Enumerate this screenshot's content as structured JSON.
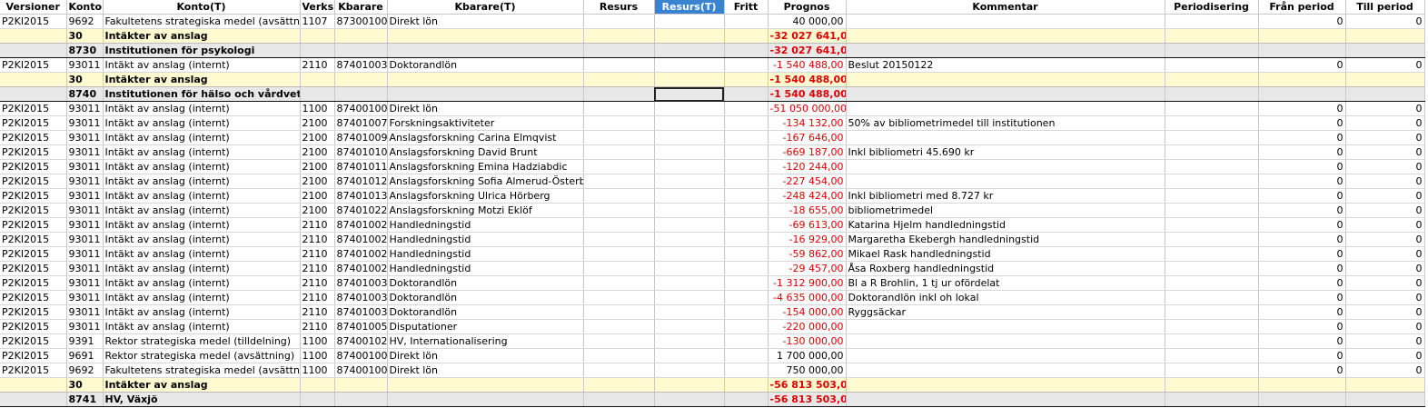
{
  "headers": [
    "Versioner",
    "Konto",
    "Konto(T)",
    "Verks",
    "Kbarare",
    "Kbarare(T)",
    "Resurs",
    "Resurs(T)",
    "Fritt",
    "Prognos",
    "Kommentar",
    "Periodisering",
    "Från period",
    "Till period"
  ],
  "rows": [
    {
      "type": "data",
      "cells": [
        "P2KI2015",
        "9692",
        "Fakultetens strategiska medel (avsättning)",
        "1107",
        "87300100",
        "Direkt lön",
        "",
        "",
        "",
        "40 000,00",
        "",
        "",
        "0",
        "0"
      ],
      "neg": false
    },
    {
      "type": "sub30",
      "cells": [
        "",
        "30",
        "Intäkter av anslag",
        "",
        "",
        "",
        "",
        "",
        "",
        "-32 027 641,00",
        "",
        "",
        "",
        ""
      ],
      "neg": true
    },
    {
      "type": "sub87",
      "cells": [
        "",
        "8730",
        "Institutionen för psykologi",
        "",
        "",
        "",
        "",
        "",
        "",
        "-32 027 641,00",
        "",
        "",
        "",
        ""
      ],
      "neg": true
    },
    {
      "type": "data",
      "cells": [
        "P2KI2015",
        "93011",
        "Intäkt av anslag (internt)",
        "2110",
        "87401003",
        "Doktorandlön",
        "",
        "",
        "",
        "-1 540 488,00",
        "Beslut 20150122",
        "",
        "0",
        "0"
      ],
      "neg": true
    },
    {
      "type": "sub30",
      "cells": [
        "",
        "30",
        "Intäkter av anslag",
        "",
        "",
        "",
        "",
        "",
        "",
        "-1 540 488,00",
        "",
        "",
        "",
        ""
      ],
      "neg": true
    },
    {
      "type": "sub87",
      "cells": [
        "",
        "8740",
        "Institutionen för hälso och vårdvetens",
        "",
        "",
        "",
        "",
        "",
        "",
        "-1 540 488,00",
        "",
        "",
        "",
        ""
      ],
      "neg": true
    },
    {
      "type": "data",
      "cells": [
        "P2KI2015",
        "93011",
        "Intäkt av anslag (internt)",
        "1100",
        "87400100",
        "Direkt lön",
        "",
        "",
        "",
        "-51 050 000,00",
        "",
        "",
        "0",
        "0"
      ],
      "neg": true
    },
    {
      "type": "data",
      "cells": [
        "P2KI2015",
        "93011",
        "Intäkt av anslag (internt)",
        "2100",
        "87401007",
        "Forskningsaktiviteter",
        "",
        "",
        "",
        "-134 132,00",
        "50% av bibliometrimedel till institutionen",
        "",
        "0",
        "0"
      ],
      "neg": true
    },
    {
      "type": "data",
      "cells": [
        "P2KI2015",
        "93011",
        "Intäkt av anslag (internt)",
        "2100",
        "87401009",
        "Anslagsforskning Carina Elmqvist",
        "",
        "",
        "",
        "-167 646,00",
        "",
        "",
        "0",
        "0"
      ],
      "neg": true
    },
    {
      "type": "data",
      "cells": [
        "P2KI2015",
        "93011",
        "Intäkt av anslag (internt)",
        "2100",
        "87401010",
        "Anslagsforskning David Brunt",
        "",
        "",
        "",
        "-669 187,00",
        "Inkl bibliometri 45.690 kr",
        "",
        "0",
        "0"
      ],
      "neg": true
    },
    {
      "type": "data",
      "cells": [
        "P2KI2015",
        "93011",
        "Intäkt av anslag (internt)",
        "2100",
        "87401011",
        "Anslagsforskning Emina Hadziabdic",
        "",
        "",
        "",
        "-120 244,00",
        "",
        "",
        "0",
        "0"
      ],
      "neg": true
    },
    {
      "type": "data",
      "cells": [
        "P2KI2015",
        "93011",
        "Intäkt av anslag (internt)",
        "2100",
        "87401012",
        "Anslagsforskning Sofia Almerud-Österberg",
        "",
        "",
        "",
        "-227 454,00",
        "",
        "",
        "0",
        "0"
      ],
      "neg": true
    },
    {
      "type": "data",
      "cells": [
        "P2KI2015",
        "93011",
        "Intäkt av anslag (internt)",
        "2100",
        "87401013",
        "Anslagsforskning Ulrica Hörberg",
        "",
        "",
        "",
        "-248 424,00",
        "Inkl bibliometri med 8.727 kr",
        "",
        "0",
        "0"
      ],
      "neg": true
    },
    {
      "type": "data",
      "cells": [
        "P2KI2015",
        "93011",
        "Intäkt av anslag (internt)",
        "2100",
        "87401022",
        "Anslagsforskning Motzi Eklöf",
        "",
        "",
        "",
        "-18 655,00",
        "bibliometrimedel",
        "",
        "0",
        "0"
      ],
      "neg": true
    },
    {
      "type": "data",
      "cells": [
        "P2KI2015",
        "93011",
        "Intäkt av anslag (internt)",
        "2110",
        "87401002",
        "Handledningstid",
        "",
        "",
        "",
        "-69 613,00",
        "Katarina Hjelm handledningstid",
        "",
        "0",
        "0"
      ],
      "neg": true
    },
    {
      "type": "data",
      "cells": [
        "P2KI2015",
        "93011",
        "Intäkt av anslag (internt)",
        "2110",
        "87401002",
        "Handledningstid",
        "",
        "",
        "",
        "-16 929,00",
        "Margaretha Ekebergh handledningstid",
        "",
        "0",
        "0"
      ],
      "neg": true
    },
    {
      "type": "data",
      "cells": [
        "P2KI2015",
        "93011",
        "Intäkt av anslag (internt)",
        "2110",
        "87401002",
        "Handledningstid",
        "",
        "",
        "",
        "-59 862,00",
        "Mikael Rask handledningstid",
        "",
        "0",
        "0"
      ],
      "neg": true
    },
    {
      "type": "data",
      "cells": [
        "P2KI2015",
        "93011",
        "Intäkt av anslag (internt)",
        "2110",
        "87401002",
        "Handledningstid",
        "",
        "",
        "",
        "-29 457,00",
        "Åsa Roxberg handledningstid",
        "",
        "0",
        "0"
      ],
      "neg": true
    },
    {
      "type": "data",
      "cells": [
        "P2KI2015",
        "93011",
        "Intäkt av anslag (internt)",
        "2110",
        "87401003",
        "Doktorandlön",
        "",
        "",
        "",
        "-1 312 900,00",
        "Bl a R Brohlin, 1 tj ur ofördelat",
        "",
        "0",
        "0"
      ],
      "neg": true
    },
    {
      "type": "data",
      "cells": [
        "P2KI2015",
        "93011",
        "Intäkt av anslag (internt)",
        "2110",
        "87401003",
        "Doktorandlön",
        "",
        "",
        "",
        "-4 635 000,00",
        "Doktorandlön inkl oh lokal",
        "",
        "0",
        "0"
      ],
      "neg": true
    },
    {
      "type": "data",
      "cells": [
        "P2KI2015",
        "93011",
        "Intäkt av anslag (internt)",
        "2110",
        "87401003",
        "Doktorandlön",
        "",
        "",
        "",
        "-154 000,00",
        "Ryggsäckar",
        "",
        "0",
        "0"
      ],
      "neg": true
    },
    {
      "type": "data",
      "cells": [
        "P2KI2015",
        "93011",
        "Intäkt av anslag (internt)",
        "2110",
        "87401005",
        "Disputationer",
        "",
        "",
        "",
        "-220 000,00",
        "",
        "",
        "0",
        "0"
      ],
      "neg": true
    },
    {
      "type": "data",
      "cells": [
        "P2KI2015",
        "9391",
        "Rektor strategiska medel (tilldelning)",
        "1100",
        "87400102",
        "HV, Internationalisering",
        "",
        "",
        "",
        "-130 000,00",
        "",
        "",
        "0",
        "0"
      ],
      "neg": true
    },
    {
      "type": "data",
      "cells": [
        "P2KI2015",
        "9691",
        "Rektor strategiska medel (avsättning)",
        "1100",
        "87400100",
        "Direkt lön",
        "",
        "",
        "",
        "1 700 000,00",
        "",
        "",
        "0",
        "0"
      ],
      "neg": false
    },
    {
      "type": "data",
      "cells": [
        "P2KI2015",
        "9692",
        "Fakultetens strategiska medel (avsättning)",
        "1100",
        "87400100",
        "Direkt lön",
        "",
        "",
        "",
        "750 000,00",
        "",
        "",
        "0",
        "0"
      ],
      "neg": false
    },
    {
      "type": "sub30",
      "cells": [
        "",
        "30",
        "Intäkter av anslag",
        "",
        "",
        "",
        "",
        "",
        "",
        "-56 813 503,00",
        "",
        "",
        "",
        ""
      ],
      "neg": true
    },
    {
      "type": "sub87",
      "cells": [
        "",
        "8741",
        "HV, Växjö",
        "",
        "",
        "",
        "",
        "",
        "",
        "-56 813 503,00",
        "",
        "",
        "",
        ""
      ],
      "neg": true
    }
  ]
}
